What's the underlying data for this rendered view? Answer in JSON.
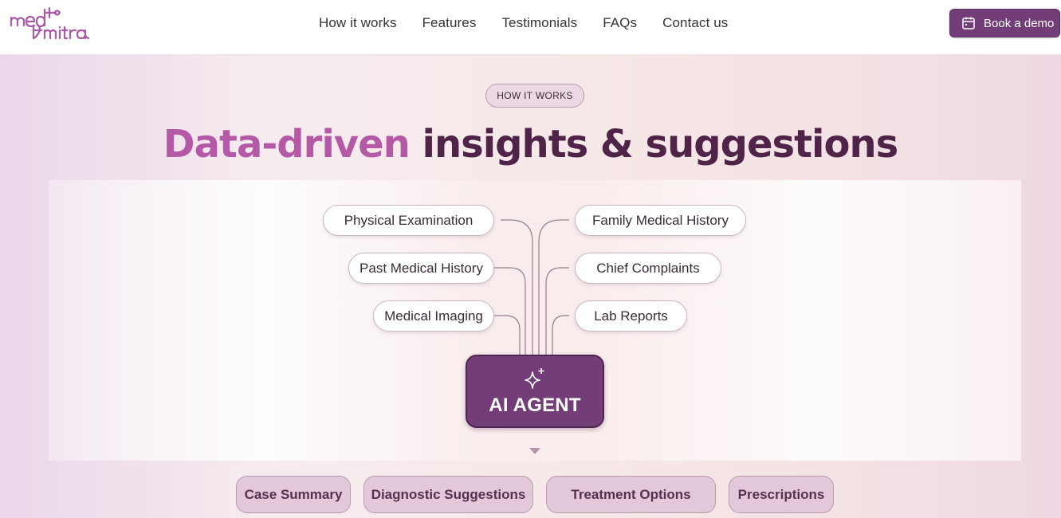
{
  "brand": {
    "logo_text": "medi mitra",
    "accent": "#733e78",
    "headline_accent": "#b359a6",
    "headline_dark": "#4f2448"
  },
  "nav": {
    "items": [
      "How it works",
      "Features",
      "Testimonials",
      "FAQs",
      "Contact us"
    ]
  },
  "header": {
    "demo_button": "Book a demo",
    "demo_icon": "calendar-icon"
  },
  "section": {
    "tag": "HOW IT WORKS",
    "headline_accent": "Data-driven",
    "headline_rest": "insights & suggestions"
  },
  "inputs_left": [
    "Physical Examination",
    "Past Medical History",
    "Medical Imaging"
  ],
  "inputs_right": [
    "Family Medical History",
    "Chief Complaints",
    "Lab Reports"
  ],
  "agent": {
    "label": "AI AGENT",
    "icon": "sparkles-icon"
  },
  "outputs": [
    "Case Summary",
    "Diagnostic Suggestions",
    "Treatment Options",
    "Prescriptions"
  ]
}
